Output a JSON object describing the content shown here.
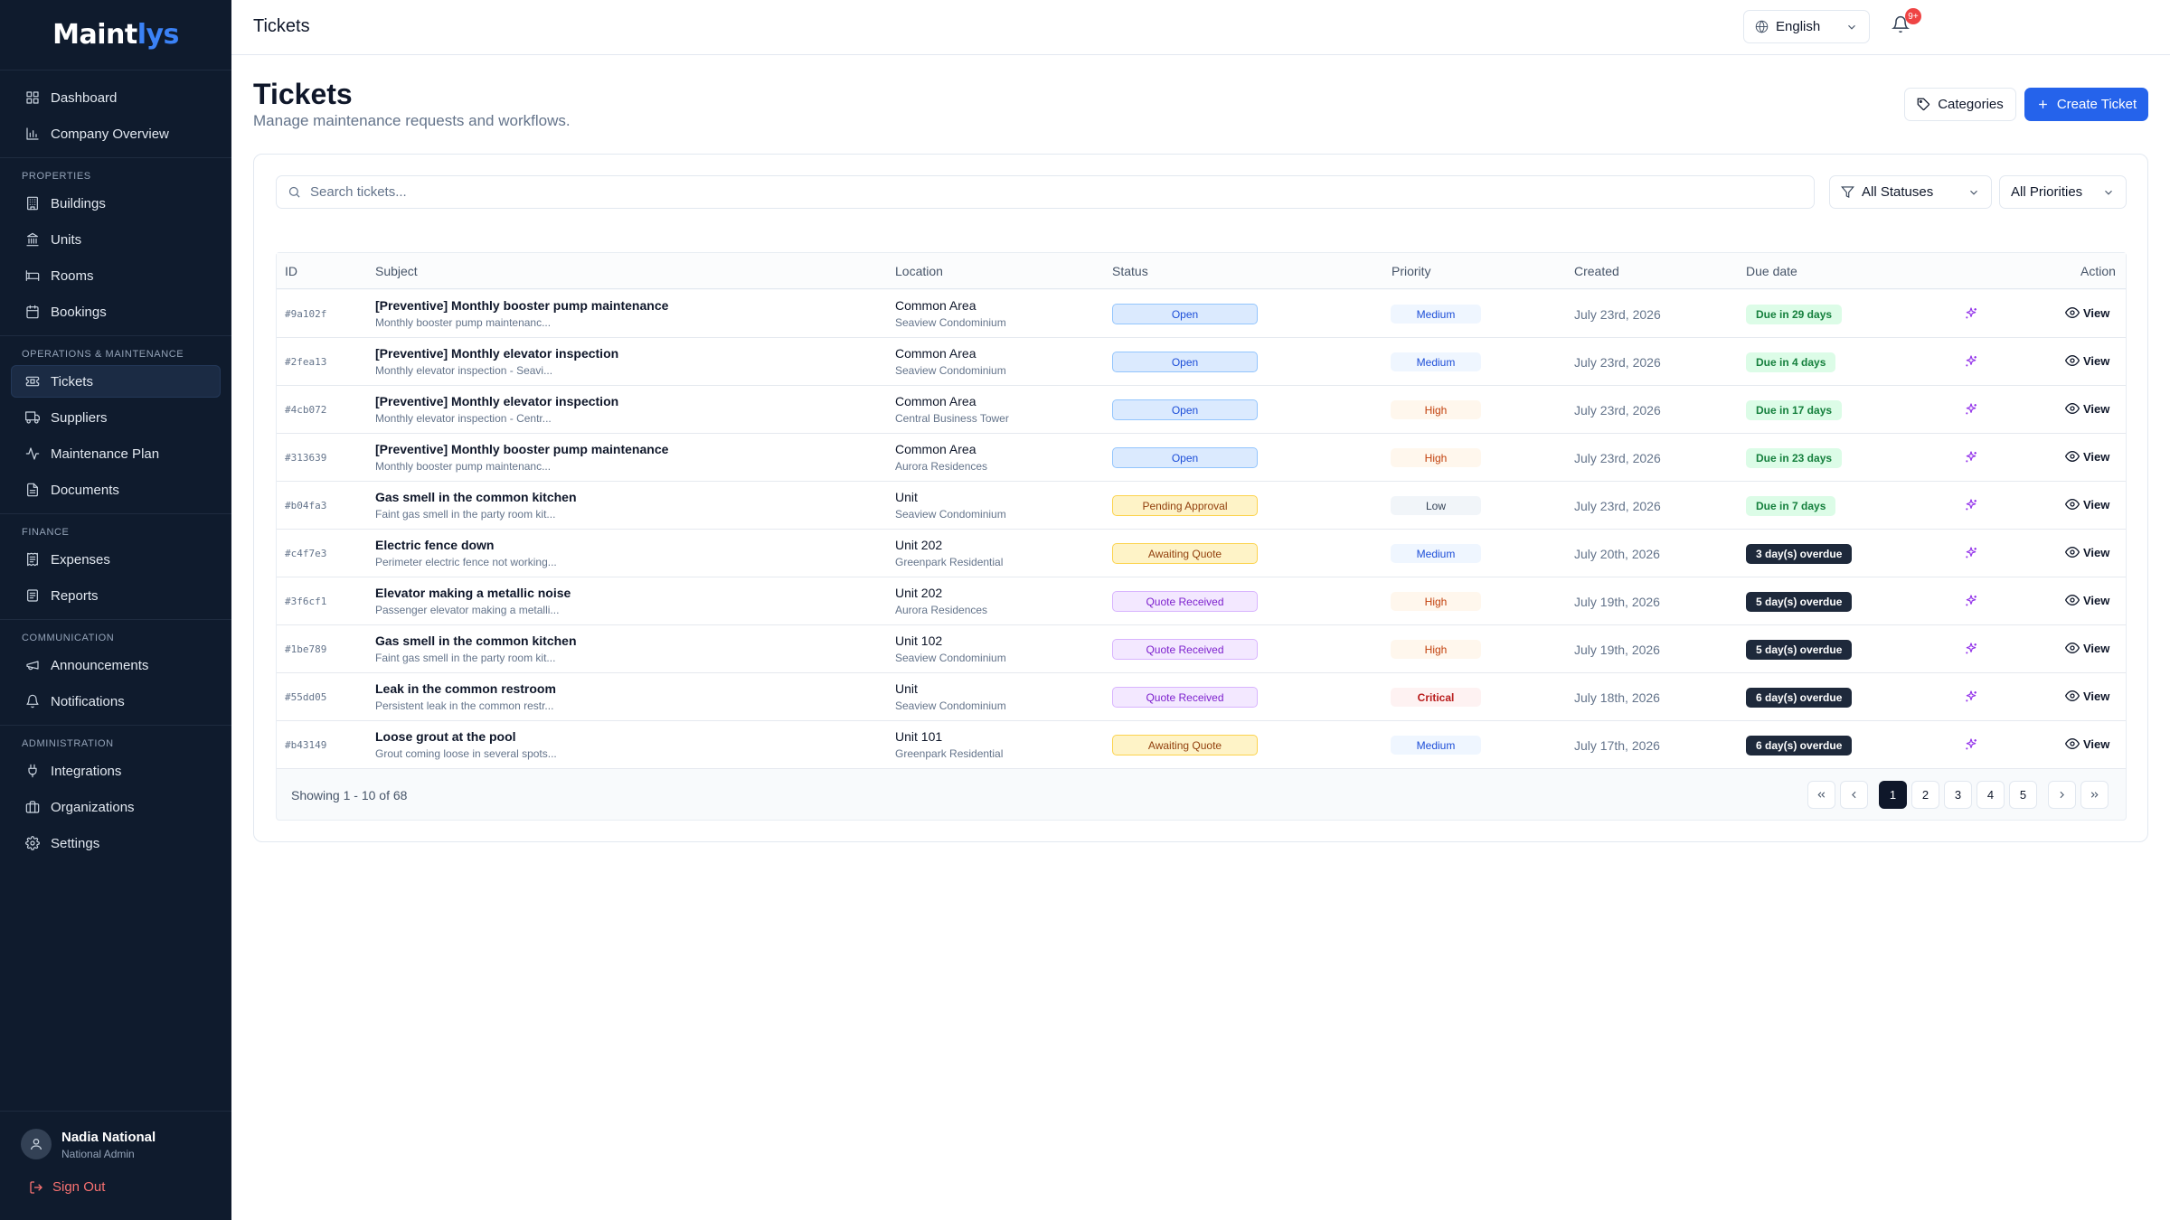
{
  "app": {
    "logo_main": "Maint",
    "logo_accent": "lys"
  },
  "sidebar": {
    "top_items": [
      {
        "label": "Dashboard",
        "icon": "dashboard-icon"
      },
      {
        "label": "Company Overview",
        "icon": "bar-chart-icon"
      }
    ],
    "sections": [
      {
        "title": "PROPERTIES",
        "items": [
          {
            "label": "Buildings",
            "icon": "building-icon"
          },
          {
            "label": "Units",
            "icon": "landmark-icon"
          },
          {
            "label": "Rooms",
            "icon": "bed-icon"
          },
          {
            "label": "Bookings",
            "icon": "calendar-icon"
          }
        ]
      },
      {
        "title": "OPERATIONS & MAINTENANCE",
        "items": [
          {
            "label": "Tickets",
            "icon": "ticket-icon",
            "active": true
          },
          {
            "label": "Suppliers",
            "icon": "truck-icon"
          },
          {
            "label": "Maintenance Plan",
            "icon": "activity-icon"
          },
          {
            "label": "Documents",
            "icon": "document-icon"
          }
        ]
      },
      {
        "title": "FINANCE",
        "items": [
          {
            "label": "Expenses",
            "icon": "receipt-icon"
          },
          {
            "label": "Reports",
            "icon": "report-icon"
          }
        ]
      },
      {
        "title": "COMMUNICATION",
        "items": [
          {
            "label": "Announcements",
            "icon": "megaphone-icon"
          },
          {
            "label": "Notifications",
            "icon": "bell-icon"
          }
        ]
      },
      {
        "title": "ADMINISTRATION",
        "items": [
          {
            "label": "Integrations",
            "icon": "plug-icon"
          },
          {
            "label": "Organizations",
            "icon": "organization-icon"
          },
          {
            "label": "Settings",
            "icon": "gear-icon"
          }
        ]
      }
    ],
    "user": {
      "name": "Nadia National",
      "role": "National Admin"
    },
    "sign_out": "Sign Out"
  },
  "topbar": {
    "title": "Tickets",
    "language": "English",
    "notification_badge": "9+"
  },
  "page": {
    "title": "Tickets",
    "subtitle": "Manage maintenance requests and workflows.",
    "categories_label": "Categories",
    "create_label": "Create Ticket"
  },
  "filters": {
    "search_placeholder": "Search tickets...",
    "status_value": "All Statuses",
    "priority_value": "All Priorities"
  },
  "table": {
    "columns": [
      "ID",
      "Subject",
      "Location",
      "Status",
      "Priority",
      "Created",
      "Due date",
      "Action"
    ],
    "view_label": "View",
    "rows": [
      {
        "id": "#9a102f",
        "subject": "[Preventive] Monthly booster pump maintenance",
        "desc": "Monthly booster pump maintenanc...",
        "location": "Common Area",
        "building": "Seaview Condominium",
        "status": "Open",
        "status_style": "open",
        "priority": "Medium",
        "priority_style": "medium",
        "created": "July 23rd, 2026",
        "due": "Due in 29 days",
        "due_style": "ok"
      },
      {
        "id": "#2fea13",
        "subject": "[Preventive] Monthly elevator inspection",
        "desc": "Monthly elevator inspection - Seavi...",
        "location": "Common Area",
        "building": "Seaview Condominium",
        "status": "Open",
        "status_style": "open",
        "priority": "Medium",
        "priority_style": "medium",
        "created": "July 23rd, 2026",
        "due": "Due in 4 days",
        "due_style": "ok"
      },
      {
        "id": "#4cb072",
        "subject": "[Preventive] Monthly elevator inspection",
        "desc": "Monthly elevator inspection - Centr...",
        "location": "Common Area",
        "building": "Central Business Tower",
        "status": "Open",
        "status_style": "open",
        "priority": "High",
        "priority_style": "high",
        "created": "July 23rd, 2026",
        "due": "Due in 17 days",
        "due_style": "ok"
      },
      {
        "id": "#313639",
        "subject": "[Preventive] Monthly booster pump maintenance",
        "desc": "Monthly booster pump maintenanc...",
        "location": "Common Area",
        "building": "Aurora Residences",
        "status": "Open",
        "status_style": "open",
        "priority": "High",
        "priority_style": "high",
        "created": "July 23rd, 2026",
        "due": "Due in 23 days",
        "due_style": "ok"
      },
      {
        "id": "#b04fa3",
        "subject": "Gas smell in the common kitchen",
        "desc": "Faint gas smell in the party room kit...",
        "location": "Unit",
        "building": "Seaview Condominium",
        "status": "Pending Approval",
        "status_style": "pending",
        "priority": "Low",
        "priority_style": "low",
        "created": "July 23rd, 2026",
        "due": "Due in 7 days",
        "due_style": "ok"
      },
      {
        "id": "#c4f7e3",
        "subject": "Electric fence down",
        "desc": "Perimeter electric fence not working...",
        "location": "Unit 202",
        "building": "Greenpark Residential",
        "status": "Awaiting Quote",
        "status_style": "awaiting",
        "priority": "Medium",
        "priority_style": "medium",
        "created": "July 20th, 2026",
        "due": "3 day(s) overdue",
        "due_style": "over"
      },
      {
        "id": "#3f6cf1",
        "subject": "Elevator making a metallic noise",
        "desc": "Passenger elevator making a metalli...",
        "location": "Unit 202",
        "building": "Aurora Residences",
        "status": "Quote Received",
        "status_style": "received",
        "priority": "High",
        "priority_style": "high",
        "created": "July 19th, 2026",
        "due": "5 day(s) overdue",
        "due_style": "over"
      },
      {
        "id": "#1be789",
        "subject": "Gas smell in the common kitchen",
        "desc": "Faint gas smell in the party room kit...",
        "location": "Unit 102",
        "building": "Seaview Condominium",
        "status": "Quote Received",
        "status_style": "received",
        "priority": "High",
        "priority_style": "high",
        "created": "July 19th, 2026",
        "due": "5 day(s) overdue",
        "due_style": "over"
      },
      {
        "id": "#55dd05",
        "subject": "Leak in the common restroom",
        "desc": "Persistent leak in the common restr...",
        "location": "Unit",
        "building": "Seaview Condominium",
        "status": "Quote Received",
        "status_style": "received",
        "priority": "Critical",
        "priority_style": "critical",
        "created": "July 18th, 2026",
        "due": "6 day(s) overdue",
        "due_style": "over"
      },
      {
        "id": "#b43149",
        "subject": "Loose grout at the pool",
        "desc": "Grout coming loose in several spots...",
        "location": "Unit 101",
        "building": "Greenpark Residential",
        "status": "Awaiting Quote",
        "status_style": "awaiting",
        "priority": "Medium",
        "priority_style": "medium",
        "created": "July 17th, 2026",
        "due": "6 day(s) overdue",
        "due_style": "over"
      }
    ]
  },
  "pagination": {
    "summary": "Showing 1 - 10 of 68",
    "pages": [
      "1",
      "2",
      "3",
      "4",
      "5"
    ],
    "current": "1"
  }
}
